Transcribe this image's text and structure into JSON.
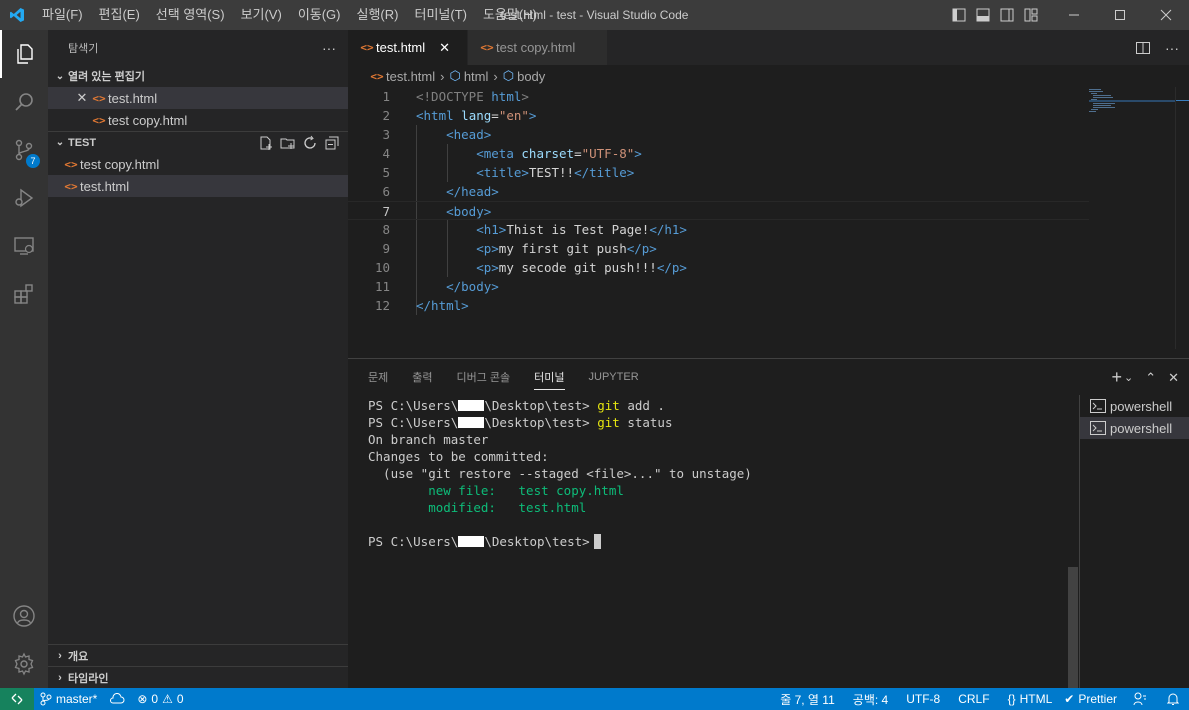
{
  "titlebar": {
    "menu": [
      "파일(F)",
      "편집(E)",
      "선택 영역(S)",
      "보기(V)",
      "이동(G)",
      "실행(R)",
      "터미널(T)",
      "도움말(H)"
    ],
    "window_title": "test.html - test - Visual Studio Code"
  },
  "activity": {
    "items": [
      "explorer-icon",
      "search-icon",
      "source-control-icon",
      "run-debug-icon",
      "remote-explorer-icon",
      "extensions-icon"
    ],
    "scm_badge": "7",
    "bottom_items": [
      "account-icon",
      "settings-gear-icon"
    ]
  },
  "sidebar": {
    "title": "탐색기",
    "more": "···",
    "open_editors": {
      "label": "열려 있는 편집기",
      "files": [
        "test.html",
        "test copy.html"
      ]
    },
    "folder": {
      "label": "TEST",
      "files": [
        "test copy.html",
        "test.html"
      ]
    },
    "outline_label": "개요",
    "timeline_label": "타임라인"
  },
  "editor": {
    "tabs": [
      "test.html",
      "test copy.html"
    ],
    "breadcrumb": [
      "test.html",
      "html",
      "body"
    ],
    "current_line": 7,
    "lines": [
      {
        "n": "1"
      },
      {
        "n": "2"
      },
      {
        "n": "3"
      },
      {
        "n": "4"
      },
      {
        "n": "5"
      },
      {
        "n": "6"
      },
      {
        "n": "7"
      },
      {
        "n": "8"
      },
      {
        "n": "9"
      },
      {
        "n": "10"
      },
      {
        "n": "11"
      },
      {
        "n": "12"
      }
    ],
    "code": {
      "doctype": "<!DOCTYPE",
      "doctype_html": "html",
      "html_open": "<html",
      "lang_attr": "lang",
      "lang_val": "\"en\"",
      "head_open": "<head>",
      "meta": "<meta",
      "charset_attr": "charset",
      "charset_val": "\"UTF-8\"",
      "title_open": "<title>",
      "title_text": "TEST!!",
      "title_close": "</title>",
      "head_close": "</head>",
      "body_open": "<body>",
      "h1_open": "<h1>",
      "h1_text": "Thist is Test Page!",
      "h1_close": "</h1>",
      "p_open": "<p>",
      "p1_text": "my first git push",
      "p_close": "</p>",
      "p2_text": "my secode git push!!!",
      "body_close": "</body>",
      "html_close": "</html>"
    }
  },
  "panel": {
    "tabs": [
      "문제",
      "출력",
      "디버그 콘솔",
      "터미널",
      "JUPYTER"
    ],
    "active_tab": "터미널",
    "terminal": {
      "prompt_prefix": "PS C:\\Users\\",
      "prompt_suffix": "\\Desktop\\test>",
      "cmd1_git": "git",
      "cmd1_args": "add .",
      "cmd2_git": "git",
      "cmd2_args": "status",
      "out1": "On branch master",
      "out2": "Changes to be committed:",
      "out3": "  (use \"git restore --staged <file>...\" to unstage)",
      "new_file": "        new file:   test copy.html",
      "modified": "        modified:   test.html"
    },
    "terminal_list": [
      "powershell",
      "powershell"
    ]
  },
  "statusbar": {
    "branch": "master*",
    "errors": "0",
    "warnings": "0",
    "position": "줄 7, 열 11",
    "spaces": "공백: 4",
    "encoding": "UTF-8",
    "eol": "CRLF",
    "language": "HTML",
    "prettier": "Prettier"
  },
  "colors": {
    "accent": "#007acc",
    "remote": "#16825d",
    "html_icon": "#e37933"
  }
}
